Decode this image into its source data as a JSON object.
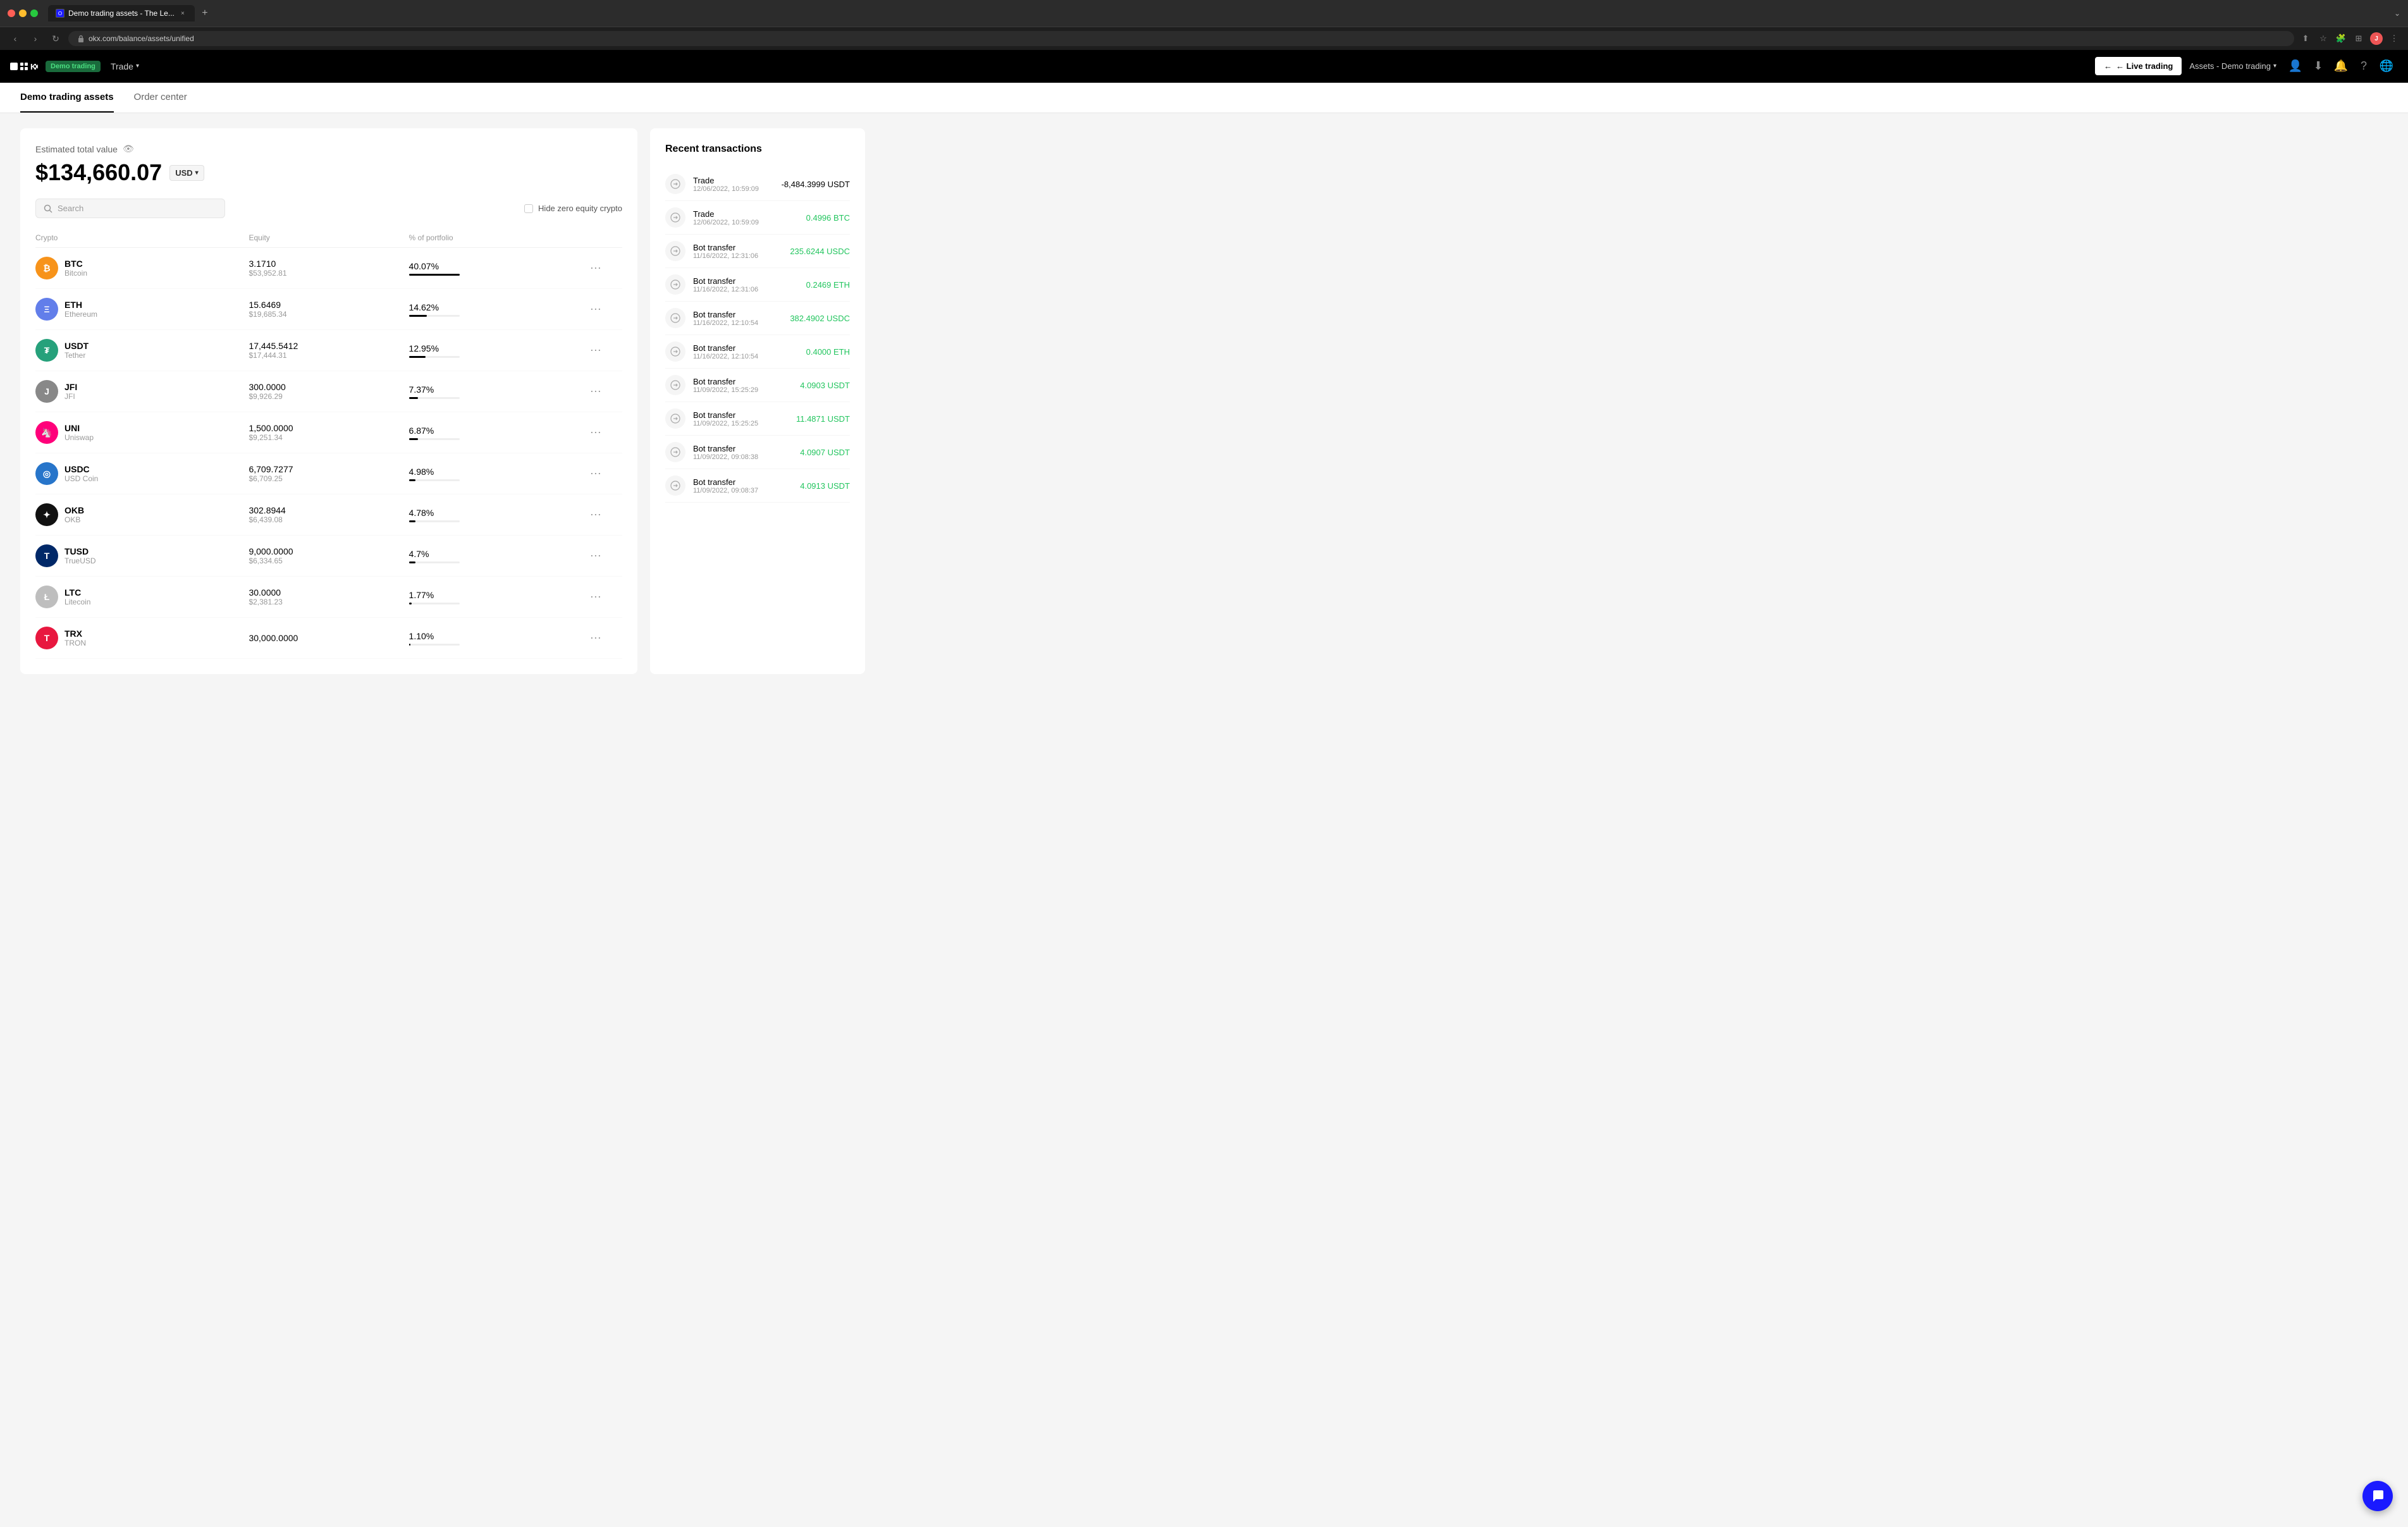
{
  "browser": {
    "tab_title": "Demo trading assets - The Le...",
    "url": "okx.com/balance/assets/unified",
    "new_tab_label": "+",
    "window_control_label": "⌄"
  },
  "navbar": {
    "logo_alt": "OKX",
    "demo_badge": "Demo trading",
    "trade_label": "Trade",
    "live_trading_label": "← Live trading",
    "assets_dropdown_label": "Assets - Demo trading"
  },
  "page": {
    "tab_active": "Demo trading assets",
    "tab_inactive": "Order center"
  },
  "portfolio": {
    "estimated_label": "Estimated total value",
    "total_value": "$134,660.07",
    "currency": "USD",
    "search_placeholder": "Search",
    "hide_zero_label": "Hide zero equity crypto",
    "columns": {
      "crypto": "Crypto",
      "equity": "Equity",
      "pct": "% of portfolio"
    },
    "assets": [
      {
        "symbol": "BTC",
        "name": "Bitcoin",
        "amount": "3.1710",
        "usd": "$53,952.81",
        "pct": "40.07%",
        "pct_num": 40,
        "color": "#f7931a",
        "icon_text": "₿"
      },
      {
        "symbol": "ETH",
        "name": "Ethereum",
        "amount": "15.6469",
        "usd": "$19,685.34",
        "pct": "14.62%",
        "pct_num": 14,
        "color": "#627eea",
        "icon_text": "Ξ"
      },
      {
        "symbol": "USDT",
        "name": "Tether",
        "amount": "17,445.5412",
        "usd": "$17,444.31",
        "pct": "12.95%",
        "pct_num": 13,
        "color": "#26a17b",
        "icon_text": "₮"
      },
      {
        "symbol": "JFI",
        "name": "JFI",
        "amount": "300.0000",
        "usd": "$9,926.29",
        "pct": "7.37%",
        "pct_num": 7,
        "color": "#888",
        "icon_text": "J"
      },
      {
        "symbol": "UNI",
        "name": "Uniswap",
        "amount": "1,500.0000",
        "usd": "$9,251.34",
        "pct": "6.87%",
        "pct_num": 7,
        "color": "#ff007a",
        "icon_text": "🦄"
      },
      {
        "symbol": "USDC",
        "name": "USD Coin",
        "amount": "6,709.7277",
        "usd": "$6,709.25",
        "pct": "4.98%",
        "pct_num": 5,
        "color": "#2775ca",
        "icon_text": "◎"
      },
      {
        "symbol": "OKB",
        "name": "OKB",
        "amount": "302.8944",
        "usd": "$6,439.08",
        "pct": "4.78%",
        "pct_num": 5,
        "color": "#111",
        "icon_text": "✦"
      },
      {
        "symbol": "TUSD",
        "name": "TrueUSD",
        "amount": "9,000.0000",
        "usd": "$6,334.65",
        "pct": "4.7%",
        "pct_num": 5,
        "color": "#002868",
        "icon_text": "T"
      },
      {
        "symbol": "LTC",
        "name": "Litecoin",
        "amount": "30.0000",
        "usd": "$2,381.23",
        "pct": "1.77%",
        "pct_num": 2,
        "color": "#bebebe",
        "icon_text": "Ł"
      },
      {
        "symbol": "TRX",
        "name": "TRON",
        "amount": "30,000.0000",
        "usd": "",
        "pct": "1.10%",
        "pct_num": 1,
        "color": "#e8173f",
        "icon_text": "T"
      }
    ]
  },
  "transactions": {
    "title": "Recent transactions",
    "items": [
      {
        "type": "Trade",
        "date": "12/06/2022, 10:59:09",
        "amount": "-8,484.3999 USDT",
        "positive": false
      },
      {
        "type": "Trade",
        "date": "12/06/2022, 10:59:09",
        "amount": "0.4996 BTC",
        "positive": true
      },
      {
        "type": "Bot transfer",
        "date": "11/16/2022, 12:31:06",
        "amount": "235.6244 USDC",
        "positive": true
      },
      {
        "type": "Bot transfer",
        "date": "11/16/2022, 12:31:06",
        "amount": "0.2469 ETH",
        "positive": true
      },
      {
        "type": "Bot transfer",
        "date": "11/16/2022, 12:10:54",
        "amount": "382.4902 USDC",
        "positive": true
      },
      {
        "type": "Bot transfer",
        "date": "11/16/2022, 12:10:54",
        "amount": "0.4000 ETH",
        "positive": true
      },
      {
        "type": "Bot transfer",
        "date": "11/09/2022, 15:25:29",
        "amount": "4.0903 USDT",
        "positive": true
      },
      {
        "type": "Bot transfer",
        "date": "11/09/2022, 15:25:25",
        "amount": "11.4871 USDT",
        "positive": true
      },
      {
        "type": "Bot transfer",
        "date": "11/09/2022, 09:08:38",
        "amount": "4.0907 USDT",
        "positive": true
      },
      {
        "type": "Bot transfer",
        "date": "11/09/2022, 09:08:37",
        "amount": "4.0913 USDT",
        "positive": true
      }
    ]
  }
}
